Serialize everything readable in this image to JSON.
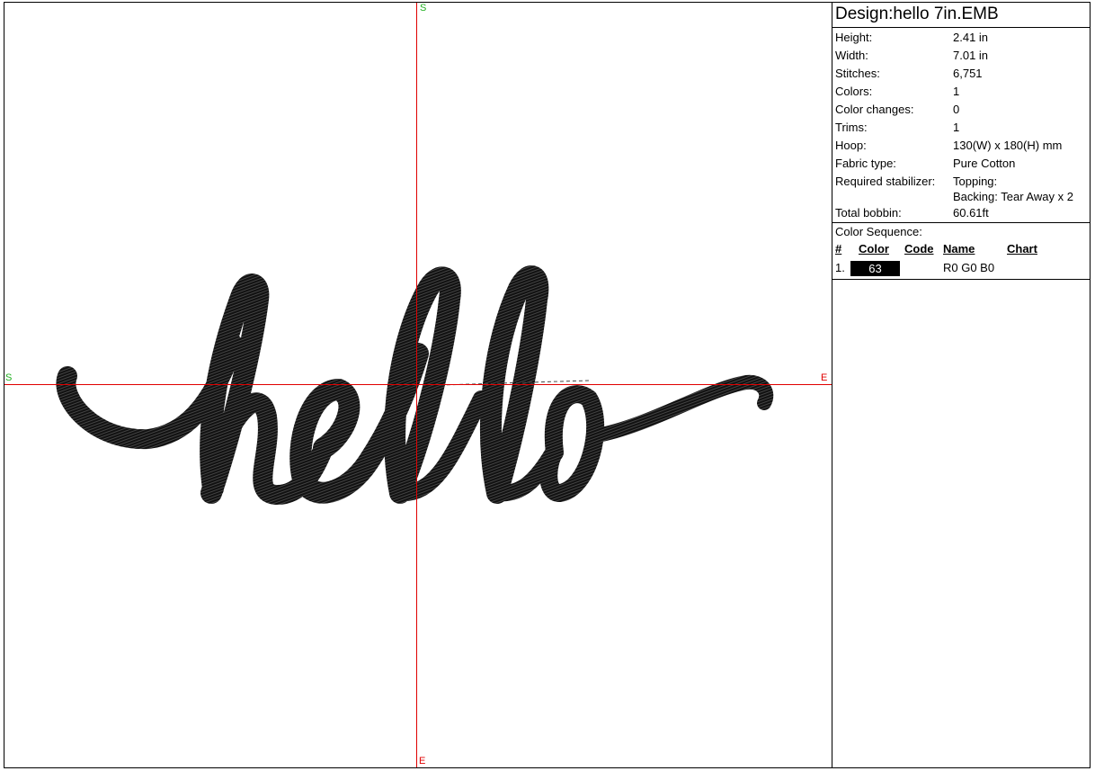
{
  "design": {
    "title": "Design:hello 7in.EMB",
    "preview_text": "hello",
    "thread_color": "#000000"
  },
  "guide_marks": {
    "top": "S",
    "left": "S",
    "right": "E",
    "bottom": "E"
  },
  "properties": [
    {
      "label": "Height:",
      "value": "2.41 in"
    },
    {
      "label": "Width:",
      "value": "7.01 in"
    },
    {
      "label": "Stitches:",
      "value": "6,751"
    },
    {
      "label": "Colors:",
      "value": "1"
    },
    {
      "label": "Color changes:",
      "value": "0"
    },
    {
      "label": "Trims:",
      "value": "1"
    },
    {
      "label": "Hoop:",
      "value": "130(W) x 180(H) mm"
    },
    {
      "label": "Fabric type:",
      "value": "Pure Cotton"
    },
    {
      "label": "Required stabilizer:",
      "value": "Topping:",
      "value2": "Backing: Tear Away x 2"
    },
    {
      "label": "Total bobbin:",
      "value": "60.61ft"
    }
  ],
  "color_sequence": {
    "title": "Color Sequence:",
    "headers": {
      "num": "#",
      "color": "Color",
      "code": "Code",
      "name": "Name",
      "chart": "Chart"
    },
    "rows": [
      {
        "num": "1.",
        "color_label": "63",
        "swatch": "#000000",
        "code": "",
        "name": "R0 G0 B0",
        "chart": ""
      }
    ]
  }
}
